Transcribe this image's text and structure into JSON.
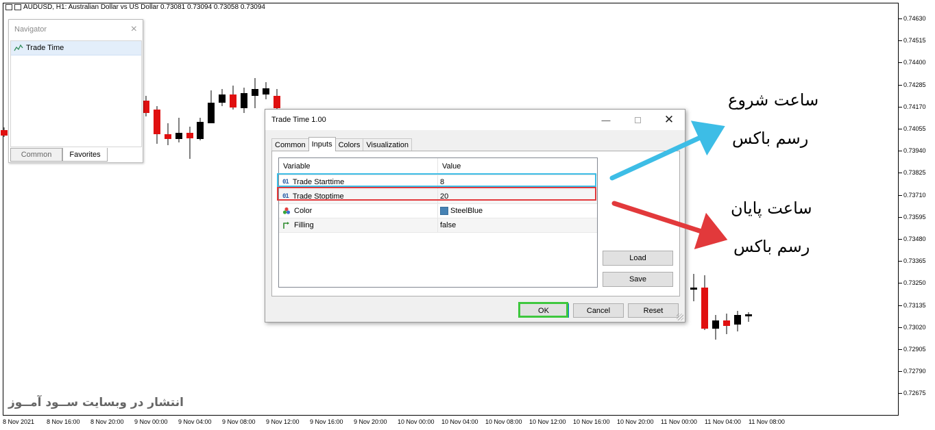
{
  "chart": {
    "title": "AUDUSD, H1:  Australian Dollar vs US Dollar  0.73081 0.73094 0.73058 0.73094",
    "price_axis": [
      "0.74630",
      "0.74515",
      "0.74400",
      "0.74285",
      "0.74170",
      "0.74055",
      "0.73940",
      "0.73825",
      "0.73710",
      "0.73595",
      "0.73480",
      "0.73365",
      "0.73250",
      "0.73135",
      "0.73020",
      "0.72905",
      "0.72790",
      "0.72675"
    ],
    "time_axis": [
      "8 Nov 2021",
      "8 Nov 16:00",
      "8 Nov 20:00",
      "9 Nov 00:00",
      "9 Nov 04:00",
      "9 Nov 08:00",
      "9 Nov 12:00",
      "9 Nov 16:00",
      "9 Nov 20:00",
      "10 Nov 00:00",
      "10 Nov 04:00",
      "10 Nov 08:00",
      "10 Nov 12:00",
      "10 Nov 16:00",
      "10 Nov 20:00",
      "11 Nov 00:00",
      "11 Nov 04:00",
      "11 Nov 08:00"
    ],
    "bull_color": "#000000",
    "bear_color": "#e01010",
    "watermark": "انتشار در وبسایت  ســود آمــوز"
  },
  "navigator": {
    "title": "Navigator",
    "item": "Trade Time",
    "tabs": [
      "Common",
      "Favorites"
    ]
  },
  "dialog": {
    "title": "Trade Time 1.00",
    "tabs": [
      "Common",
      "Inputs",
      "Colors",
      "Visualization"
    ],
    "columns": [
      "Variable",
      "Value"
    ],
    "rows": [
      {
        "variable": "Trade Starttime",
        "value": "8",
        "icon": "01"
      },
      {
        "variable": "Trade Stoptime",
        "value": "20",
        "icon": "01"
      },
      {
        "variable": "Color",
        "value": "SteelBlue",
        "icon": "color-icon"
      },
      {
        "variable": "Filling",
        "value": "false",
        "icon": "bool-icon"
      }
    ],
    "swatch_color": "#4682B4",
    "load_label": "Load",
    "save_label": "Save",
    "ok_label": "OK",
    "cancel_label": "Cancel",
    "reset_label": "Reset"
  },
  "annotations": {
    "start_line1": "ساعت شروع",
    "start_line2": "رسم باکس",
    "end_line1": "ساعت پایان",
    "end_line2": "رسم باکس",
    "blue": "#3dbde6",
    "red": "#e2393b",
    "green": "#3ec73e"
  }
}
